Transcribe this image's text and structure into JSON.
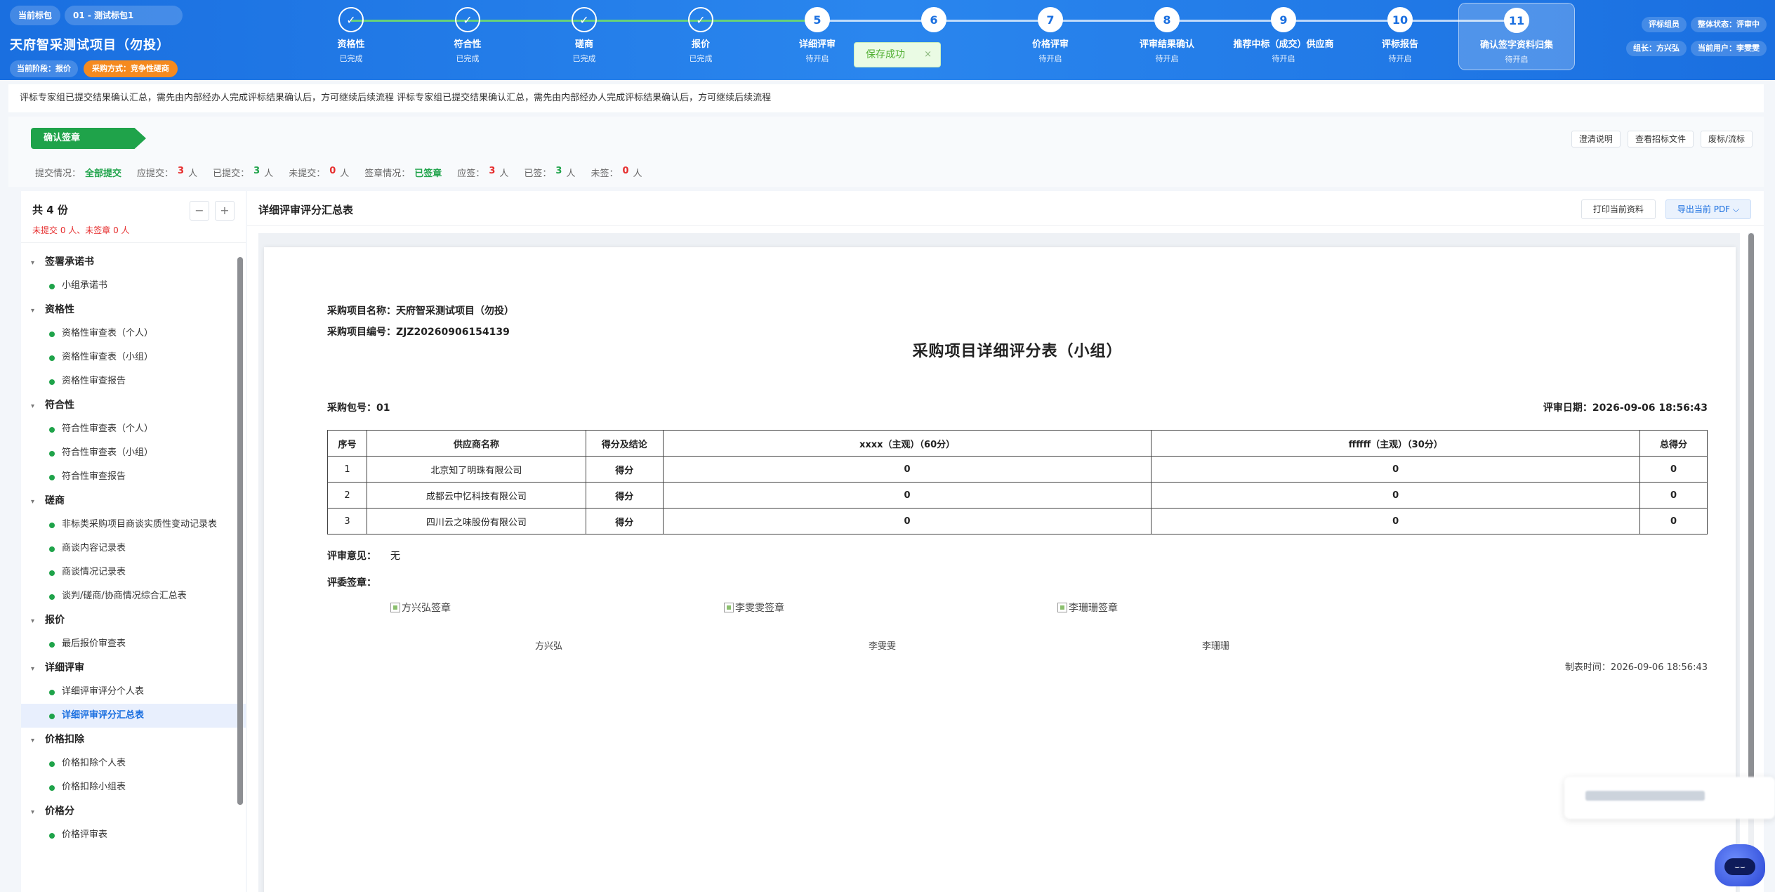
{
  "header": {
    "current_label": "当前标包",
    "current_pkg": "01 - 测试标包1",
    "project_title": "天府智采测试项目（勿投）",
    "stage": "当前阶段：报价",
    "method": "采购方式：竞争性磋商",
    "role": "评标组员",
    "status": "整体状态：评审中",
    "leader": "组长：方兴弘",
    "user": "当前用户：李雯雯"
  },
  "steps": [
    {
      "num": "✓",
      "label": "资格性",
      "status": "已完成",
      "done": true
    },
    {
      "num": "✓",
      "label": "符合性",
      "status": "已完成",
      "done": true
    },
    {
      "num": "✓",
      "label": "磋商",
      "status": "已完成",
      "done": true
    },
    {
      "num": "✓",
      "label": "报价",
      "status": "已完成",
      "done": true
    },
    {
      "num": "5",
      "label": "详细评审",
      "status": "待开启",
      "done": false
    },
    {
      "num": "6",
      "label": "",
      "status": "",
      "done": false
    },
    {
      "num": "7",
      "label": "价格评审",
      "status": "待开启",
      "done": false
    },
    {
      "num": "8",
      "label": "评审结果确认",
      "status": "待开启",
      "done": false
    },
    {
      "num": "9",
      "label": "推荐中标（成交）供应商",
      "status": "待开启",
      "done": false
    },
    {
      "num": "10",
      "label": "评标报告",
      "status": "待开启",
      "done": false
    },
    {
      "num": "11",
      "label": "确认签字资料归集",
      "status": "待开启",
      "done": false,
      "active": true
    }
  ],
  "toast": {
    "text": "保存成功",
    "close": "×"
  },
  "notice": "评标专家组已提交结果确认汇总，需先由内部经办人完成评标结果确认后，方可继续后续流程 评标专家组已提交结果确认汇总，需先由内部经办人完成评标结果确认后，方可继续后续流程",
  "confirm": {
    "tag": "确认签章",
    "btn_clarify": "澄清说明",
    "btn_tender": "查看招标文件",
    "btn_abandon": "废标/流标"
  },
  "stats": {
    "submit_label": "提交情况：",
    "submit_value": "全部提交",
    "should_label": "应提交：",
    "should_value": "3",
    "submitted_label": "已提交：",
    "submitted_value": "3",
    "unsubmitted_label": "未提交：",
    "unsubmitted_value": "0",
    "sign_label": "签章情况：",
    "sign_value": "已签章",
    "should_sign_label": "应签：",
    "should_sign_value": "3",
    "signed_label": "已签：",
    "signed_value": "3",
    "unsigned_label": "未签：",
    "unsigned_value": "0",
    "unit": "人"
  },
  "sidebar": {
    "count": "共 4 份",
    "warn": "未提交 0 人、未签章 0 人",
    "minus": "−",
    "plus": "+",
    "groups": [
      {
        "name": "签署承诺书",
        "items": [
          "小组承诺书"
        ]
      },
      {
        "name": "资格性",
        "items": [
          "资格性审查表（个人）",
          "资格性审查表（小组）",
          "资格性审查报告"
        ]
      },
      {
        "name": "符合性",
        "items": [
          "符合性审查表（个人）",
          "符合性审查表（小组）",
          "符合性审查报告"
        ]
      },
      {
        "name": "磋商",
        "items": [
          "非标类采购项目商谈实质性变动记录表",
          "商谈内容记录表",
          "商谈情况记录表",
          "谈判/磋商/协商情况综合汇总表"
        ]
      },
      {
        "name": "报价",
        "items": [
          "最后报价审查表"
        ]
      },
      {
        "name": "详细评审",
        "items": [
          "详细评审评分个人表",
          "详细评审评分汇总表"
        ]
      },
      {
        "name": "价格扣除",
        "items": [
          "价格扣除个人表",
          "价格扣除小组表"
        ]
      },
      {
        "name": "价格分",
        "items": [
          "价格评审表"
        ]
      }
    ],
    "selected": "详细评审评分汇总表"
  },
  "main": {
    "title": "详细评审评分汇总表",
    "print_btn": "打印当前资料",
    "export_btn": "导出当前 PDF ⌵"
  },
  "doc": {
    "project_name_label": "采购项目名称：",
    "project_name": "天府智采测试项目（勿投）",
    "project_no_label": "采购项目编号：",
    "project_no": "ZJZ20260906154139",
    "title": "采购项目详细评分表（小组）",
    "pkg_label": "采购包号：",
    "pkg": "01",
    "date_label": "评审日期：",
    "date": "2026-09-06 18:56:43",
    "headers": [
      "序号",
      "供应商名称",
      "得分及结论",
      "xxxx（主观）（60分）",
      "ffffff（主观）（30分）",
      "总得分"
    ],
    "rows": [
      [
        "1",
        "北京知了明珠有限公司",
        "得分",
        "0",
        "0",
        "0"
      ],
      [
        "2",
        "成都云中忆科技有限公司",
        "得分",
        "0",
        "0",
        "0"
      ],
      [
        "3",
        "四川云之味股份有限公司",
        "得分",
        "0",
        "0",
        "0"
      ]
    ],
    "opinion_label": "评审意见：",
    "opinion": "无",
    "sign_label": "评委签章：",
    "signers": [
      {
        "alt": "方兴弘签章",
        "name": "方兴弘"
      },
      {
        "alt": "李雯雯签章",
        "name": "李雯雯"
      },
      {
        "alt": "李珊珊签章",
        "name": "李珊珊"
      }
    ],
    "made_time": "制表时间：2026-09-06 18:56:43"
  },
  "colors": {
    "primary": "#1a6fe0",
    "success": "#1fa34a",
    "danger": "#e62d2d",
    "orange": "#f58a1f"
  }
}
